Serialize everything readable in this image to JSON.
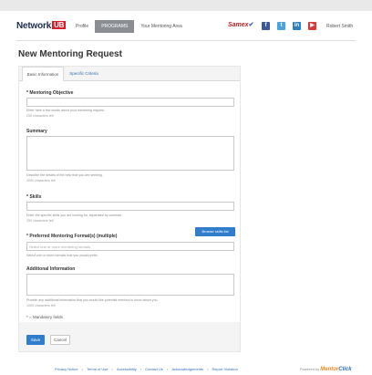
{
  "header": {
    "logo_text": "Network",
    "logo_badge": "UB",
    "nav_tabs": [
      "Profile",
      "PROGRAMS",
      "Your Mentoring Area"
    ],
    "brand_text": "Samex",
    "brand_mark": "✔",
    "social": [
      "f",
      "t",
      "in",
      "▶"
    ],
    "user_nav": "Robert Smith"
  },
  "page": {
    "title": "New Mentoring Request"
  },
  "form": {
    "tabs": [
      "Basic Information",
      "Specific Criteria"
    ],
    "objective": {
      "label": "* Mentoring Objective",
      "help": "Enter here a few words about your mentoring request.",
      "counter": "250 characters left"
    },
    "summary": {
      "label": "Summary",
      "help": "Describe the details of the help that you are seeking.",
      "counter": "3000 characters left"
    },
    "skills": {
      "label": "* Skills",
      "help": "Enter the specific skills you are looking for, separated by commas.",
      "counter": "250 characters left",
      "browse_label": "Browse skills list"
    },
    "formats": {
      "label": "* Preferred Mentoring Format(s) (multiple)",
      "placeholder": "Select one or more mentoring formats",
      "help": "Select one or more formats that you would prefer."
    },
    "additional": {
      "label": "Additional Information",
      "help": "Provide any additional information that you would like potential mentors to know about you.",
      "counter": "1000 characters left"
    },
    "mandatory_note": "* = Mandatory fields",
    "save_label": "Save",
    "cancel_label": "Cancel"
  },
  "footer": {
    "links": [
      "Privacy Notice",
      "Terms of Use",
      "Accessibility",
      "Contact Us",
      "Acknowledgements",
      "Report Violation"
    ],
    "powered_label": "Powered by",
    "powered_brand_1": "Mentor",
    "powered_brand_2": "Click"
  }
}
